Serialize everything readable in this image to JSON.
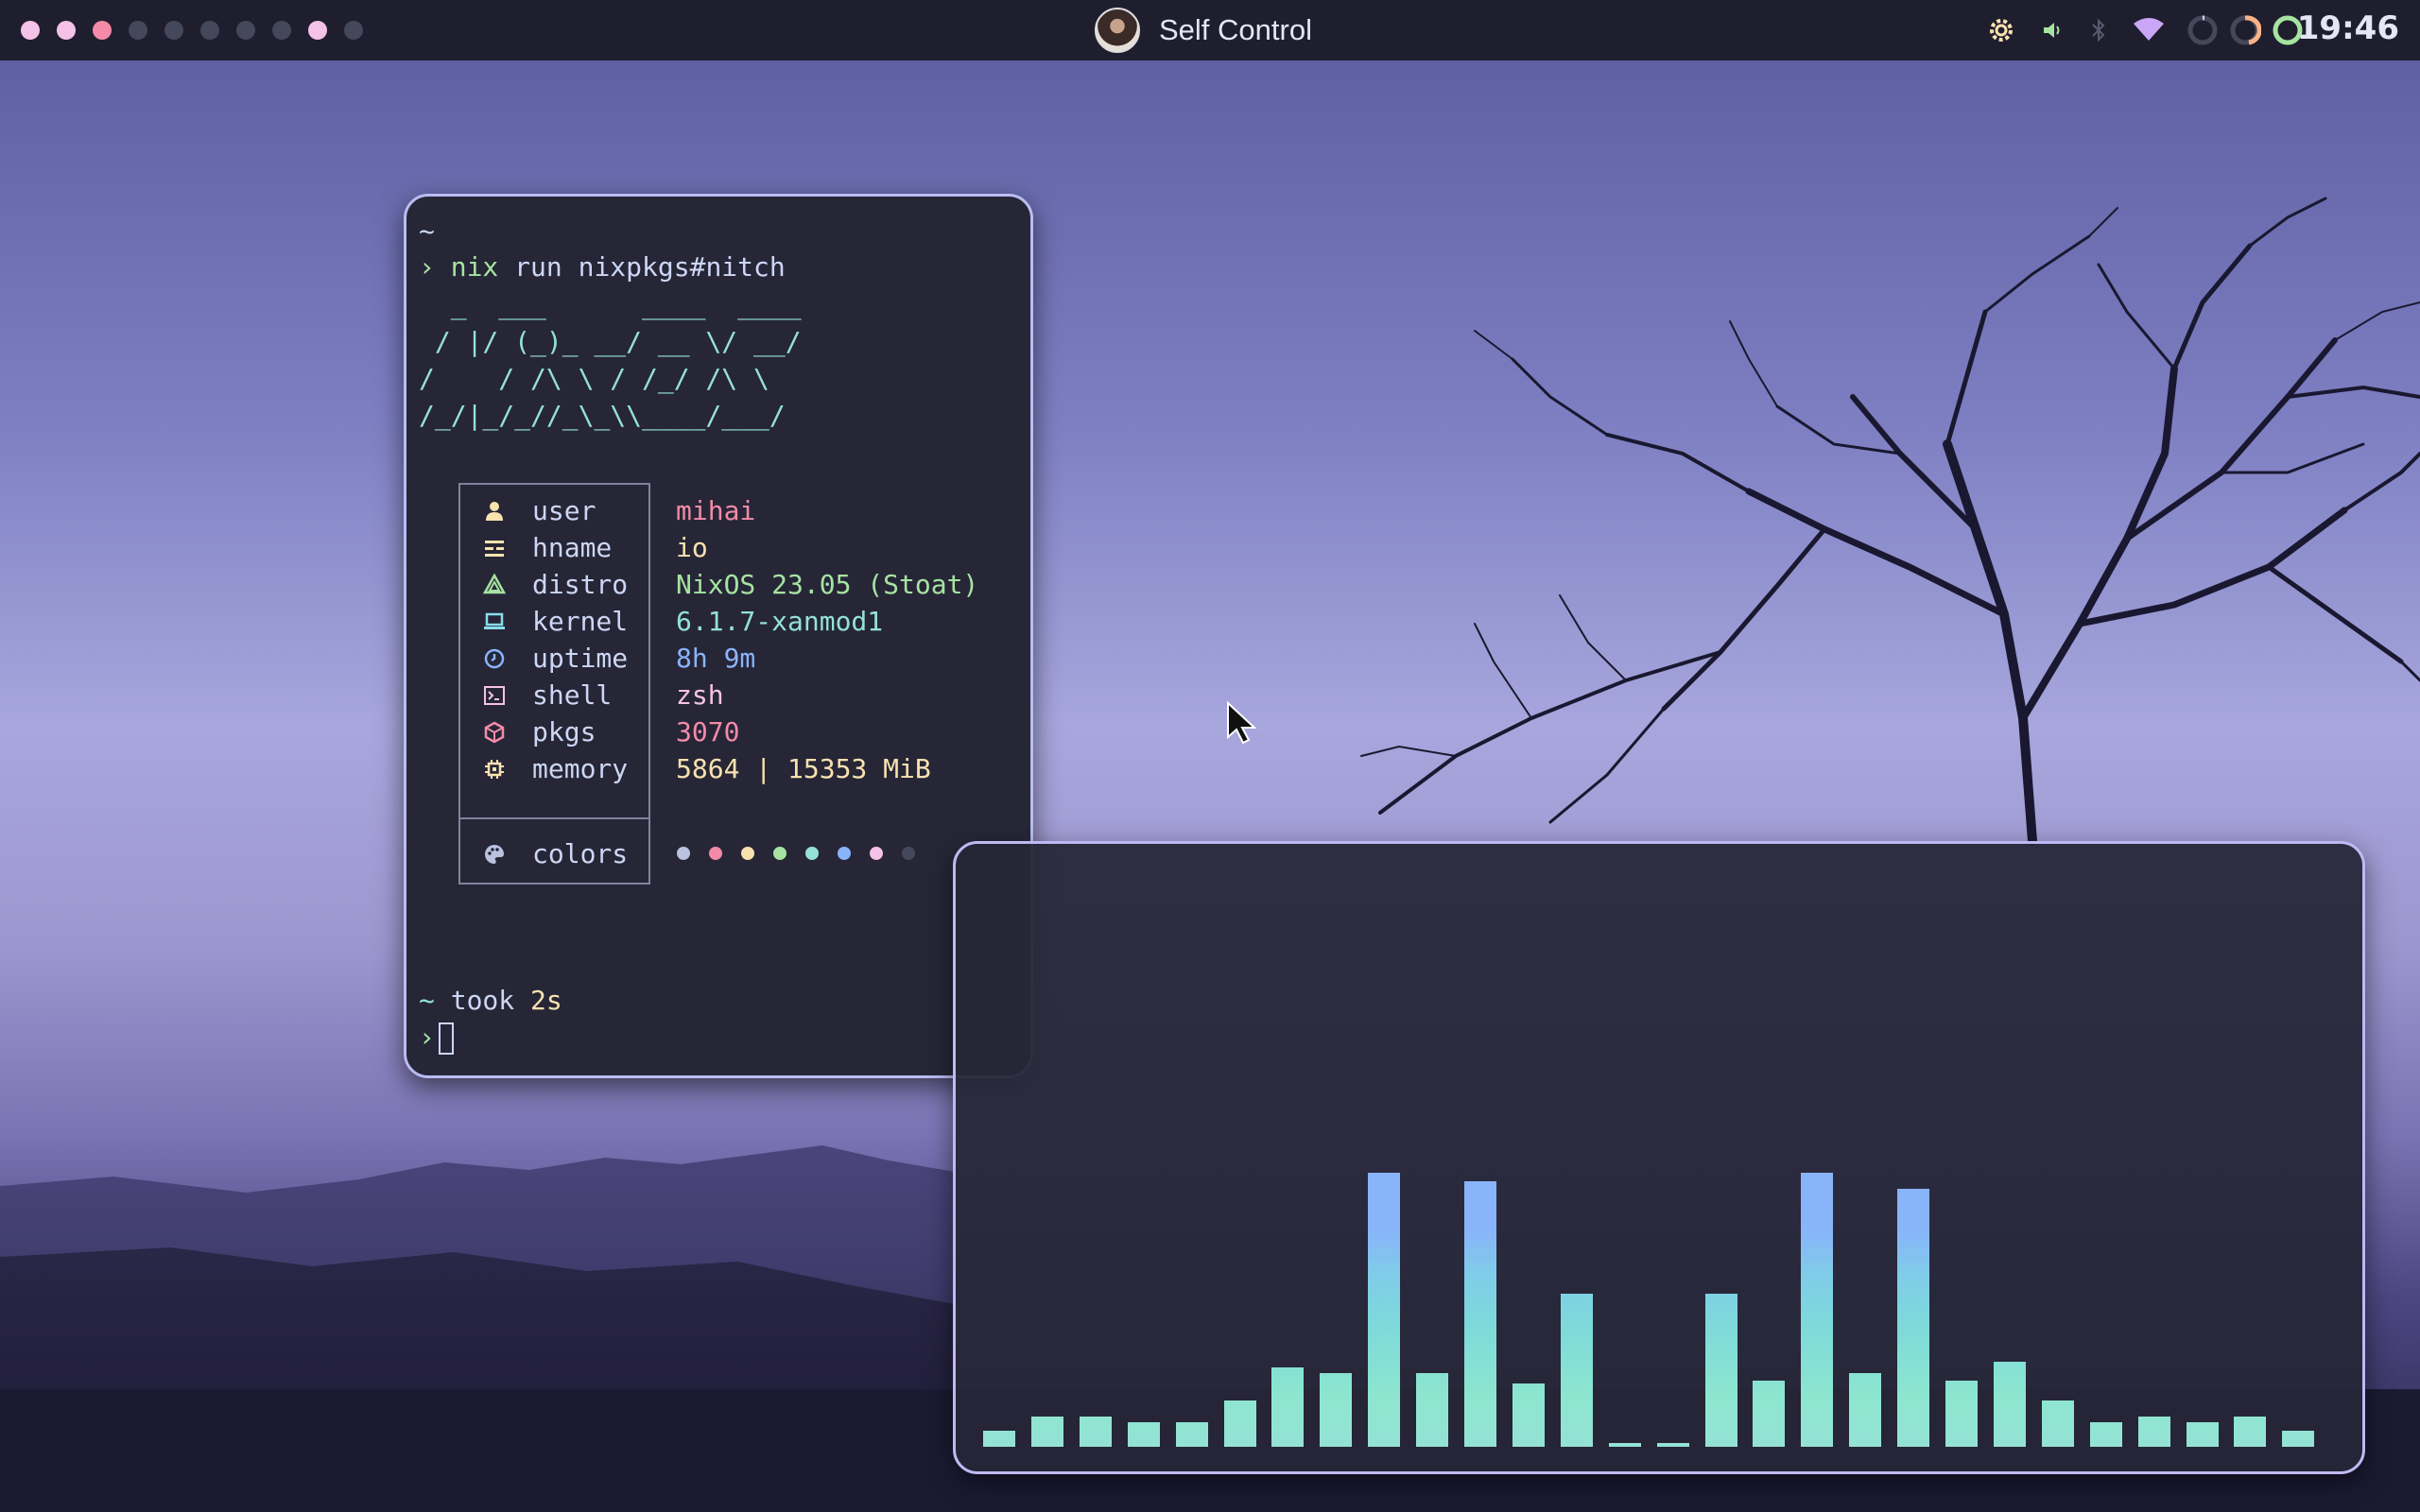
{
  "topbar": {
    "workspaces": [
      {
        "id": 1,
        "color": "#f5c2e7"
      },
      {
        "id": 2,
        "color": "#f5c2e7"
      },
      {
        "id": 3,
        "color": "#f38ba8"
      },
      {
        "id": 4,
        "color": "#45475a"
      },
      {
        "id": 5,
        "color": "#45475a"
      },
      {
        "id": 6,
        "color": "#45475a"
      },
      {
        "id": 7,
        "color": "#45475a"
      },
      {
        "id": 8,
        "color": "#45475a"
      },
      {
        "id": 9,
        "color": "#f5c2e7"
      },
      {
        "id": 10,
        "color": "#45475a"
      }
    ],
    "active_window_title": "Self Control",
    "tray_icons": [
      "gear-icon",
      "volume-icon",
      "bluetooth-icon",
      "wifi-icon",
      "cpu-ring-icon",
      "memory-ring-icon",
      "battery-ring-icon"
    ],
    "clock": "19:46"
  },
  "terminal": {
    "tilde": "~",
    "prompt_symbol": "›",
    "command_word": "nix",
    "command_rest": " run nixpkgs#nitch",
    "ascii_art": [
      "  _  ___      ____  ____",
      " / |/ (_)_ __/ __ \\/ __/",
      "/    / /\\ \\ / /_/ /\\ \\",
      "/_/|_/_//_\\_\\\\____/___/"
    ],
    "info": [
      {
        "icon": "user-icon",
        "label": "user",
        "value": "mihai",
        "color": "#f38ba8"
      },
      {
        "icon": "hostname-icon",
        "label": "hname",
        "value": "io",
        "color": "#f9e2af"
      },
      {
        "icon": "distro-icon",
        "label": "distro",
        "value": "NixOS 23.05 (Stoat)",
        "color": "#a6e3a1"
      },
      {
        "icon": "laptop-icon",
        "label": "kernel",
        "value": "6.1.7-xanmod1",
        "color": "#94e2d5"
      },
      {
        "icon": "clock-icon",
        "label": "uptime",
        "value": "8h 9m",
        "color": "#89b4fa"
      },
      {
        "icon": "terminal-icon",
        "label": "shell",
        "value": "zsh",
        "color": "#f5c2e7"
      },
      {
        "icon": "package-icon",
        "label": "pkgs",
        "value": "3070",
        "color": "#f38ba8"
      },
      {
        "icon": "chip-icon",
        "label": "memory",
        "value": "5864 | 15353 MiB",
        "color": "#f9e2af"
      }
    ],
    "colors_label": "colors",
    "color_dots": [
      "#bac2de",
      "#f38ba8",
      "#f9e2af",
      "#a6e3a1",
      "#94e2d5",
      "#89b4fa",
      "#f5c2e7",
      "#45475a"
    ],
    "took_prefix": "~",
    "took_label": " took ",
    "took_value": "2s"
  },
  "visualizer": {
    "levels": [
      0.06,
      0.11,
      0.11,
      0.09,
      0.09,
      0.17,
      0.29,
      0.27,
      1.0,
      0.27,
      0.97,
      0.23,
      0.56,
      0.01,
      0.01,
      0.56,
      0.24,
      1.0,
      0.27,
      0.94,
      0.24,
      0.31,
      0.17,
      0.09,
      0.11,
      0.09,
      0.11,
      0.06
    ]
  }
}
